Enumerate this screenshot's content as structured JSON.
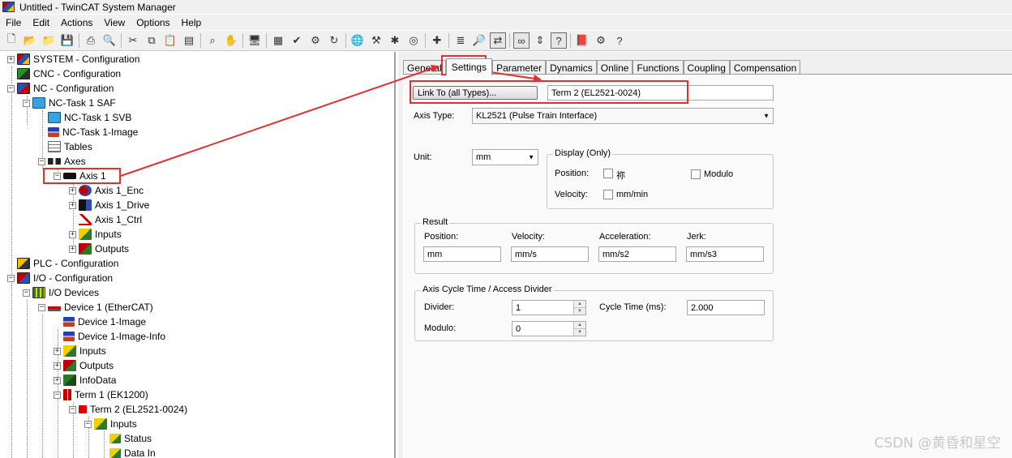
{
  "window": {
    "title": "Untitled - TwinCAT System Manager"
  },
  "menu": [
    "File",
    "Edit",
    "Actions",
    "View",
    "Options",
    "Help"
  ],
  "toolbar": {
    "icons": [
      "new-icon",
      "open-icon",
      "open-folder-icon",
      "save-icon",
      "print-icon",
      "print-preview-icon",
      "cut-icon",
      "copy-icon",
      "paste-icon",
      "paste-special-icon",
      "find-icon",
      "hand-icon",
      "monitor-icon",
      "build-icon",
      "check-icon",
      "activate-icon",
      "restart-icon",
      "network-icon",
      "config-icon",
      "scan-icon",
      "target-icon",
      "plugin-icon",
      "variables-icon",
      "zoom-icon",
      "toggle-icon",
      "glasses-icon",
      "move-icon",
      "help-link-icon",
      "book-icon",
      "settings-icon",
      "question-icon"
    ]
  },
  "tree": {
    "items": [
      {
        "label": "SYSTEM - Configuration"
      },
      {
        "label": "CNC - Configuration"
      },
      {
        "label": "NC - Configuration"
      },
      {
        "label": "NC-Task 1 SAF"
      },
      {
        "label": "NC-Task 1 SVB"
      },
      {
        "label": "NC-Task 1-Image"
      },
      {
        "label": "Tables"
      },
      {
        "label": "Axes"
      },
      {
        "label": "Axis 1"
      },
      {
        "label": "Axis 1_Enc"
      },
      {
        "label": "Axis 1_Drive"
      },
      {
        "label": "Axis 1_Ctrl"
      },
      {
        "label": "Inputs"
      },
      {
        "label": "Outputs"
      },
      {
        "label": "PLC - Configuration"
      },
      {
        "label": "I/O - Configuration"
      },
      {
        "label": "I/O Devices"
      },
      {
        "label": "Device 1 (EtherCAT)"
      },
      {
        "label": "Device 1-Image"
      },
      {
        "label": "Device 1-Image-Info"
      },
      {
        "label": "Inputs"
      },
      {
        "label": "Outputs"
      },
      {
        "label": "InfoData"
      },
      {
        "label": "Term 1 (EK1200)"
      },
      {
        "label": "Term 2 (EL2521-0024)"
      },
      {
        "label": "Inputs"
      },
      {
        "label": "Status"
      },
      {
        "label": "Data In"
      }
    ]
  },
  "tabs": [
    "General",
    "Settings",
    "Parameter",
    "Dynamics",
    "Online",
    "Functions",
    "Coupling",
    "Compensation"
  ],
  "settings": {
    "link_button": "Link To (all Types)...",
    "link_value": "Term 2 (EL2521-0024)",
    "axis_type_label": "Axis Type:",
    "axis_type_value": "KL2521 (Pulse Train Interface)",
    "unit_label": "Unit:",
    "unit_value": "mm",
    "display_group": "Display (Only)",
    "position_label": "Position:",
    "position_check": "祢",
    "modulo_check": "Modulo",
    "velocity_label": "Velocity:",
    "velocity_check": "mm/min",
    "result_group": "Result",
    "result_position_label": "Position:",
    "result_velocity_label": "Velocity:",
    "result_accel_label": "Acceleration:",
    "result_jerk_label": "Jerk:",
    "result_position": "mm",
    "result_velocity": "mm/s",
    "result_accel": "mm/s2",
    "result_jerk": "mm/s3",
    "cycle_group": "Axis Cycle Time / Access Divider",
    "divider_label": "Divider:",
    "divider_value": "1",
    "cycle_time_label": "Cycle Time (ms):",
    "cycle_time_value": "2.000",
    "modulo_label": "Modulo:",
    "modulo_value": "0"
  },
  "watermark": "CSDN @黄昏和星空",
  "colors": {
    "highlight": "#e03030"
  }
}
